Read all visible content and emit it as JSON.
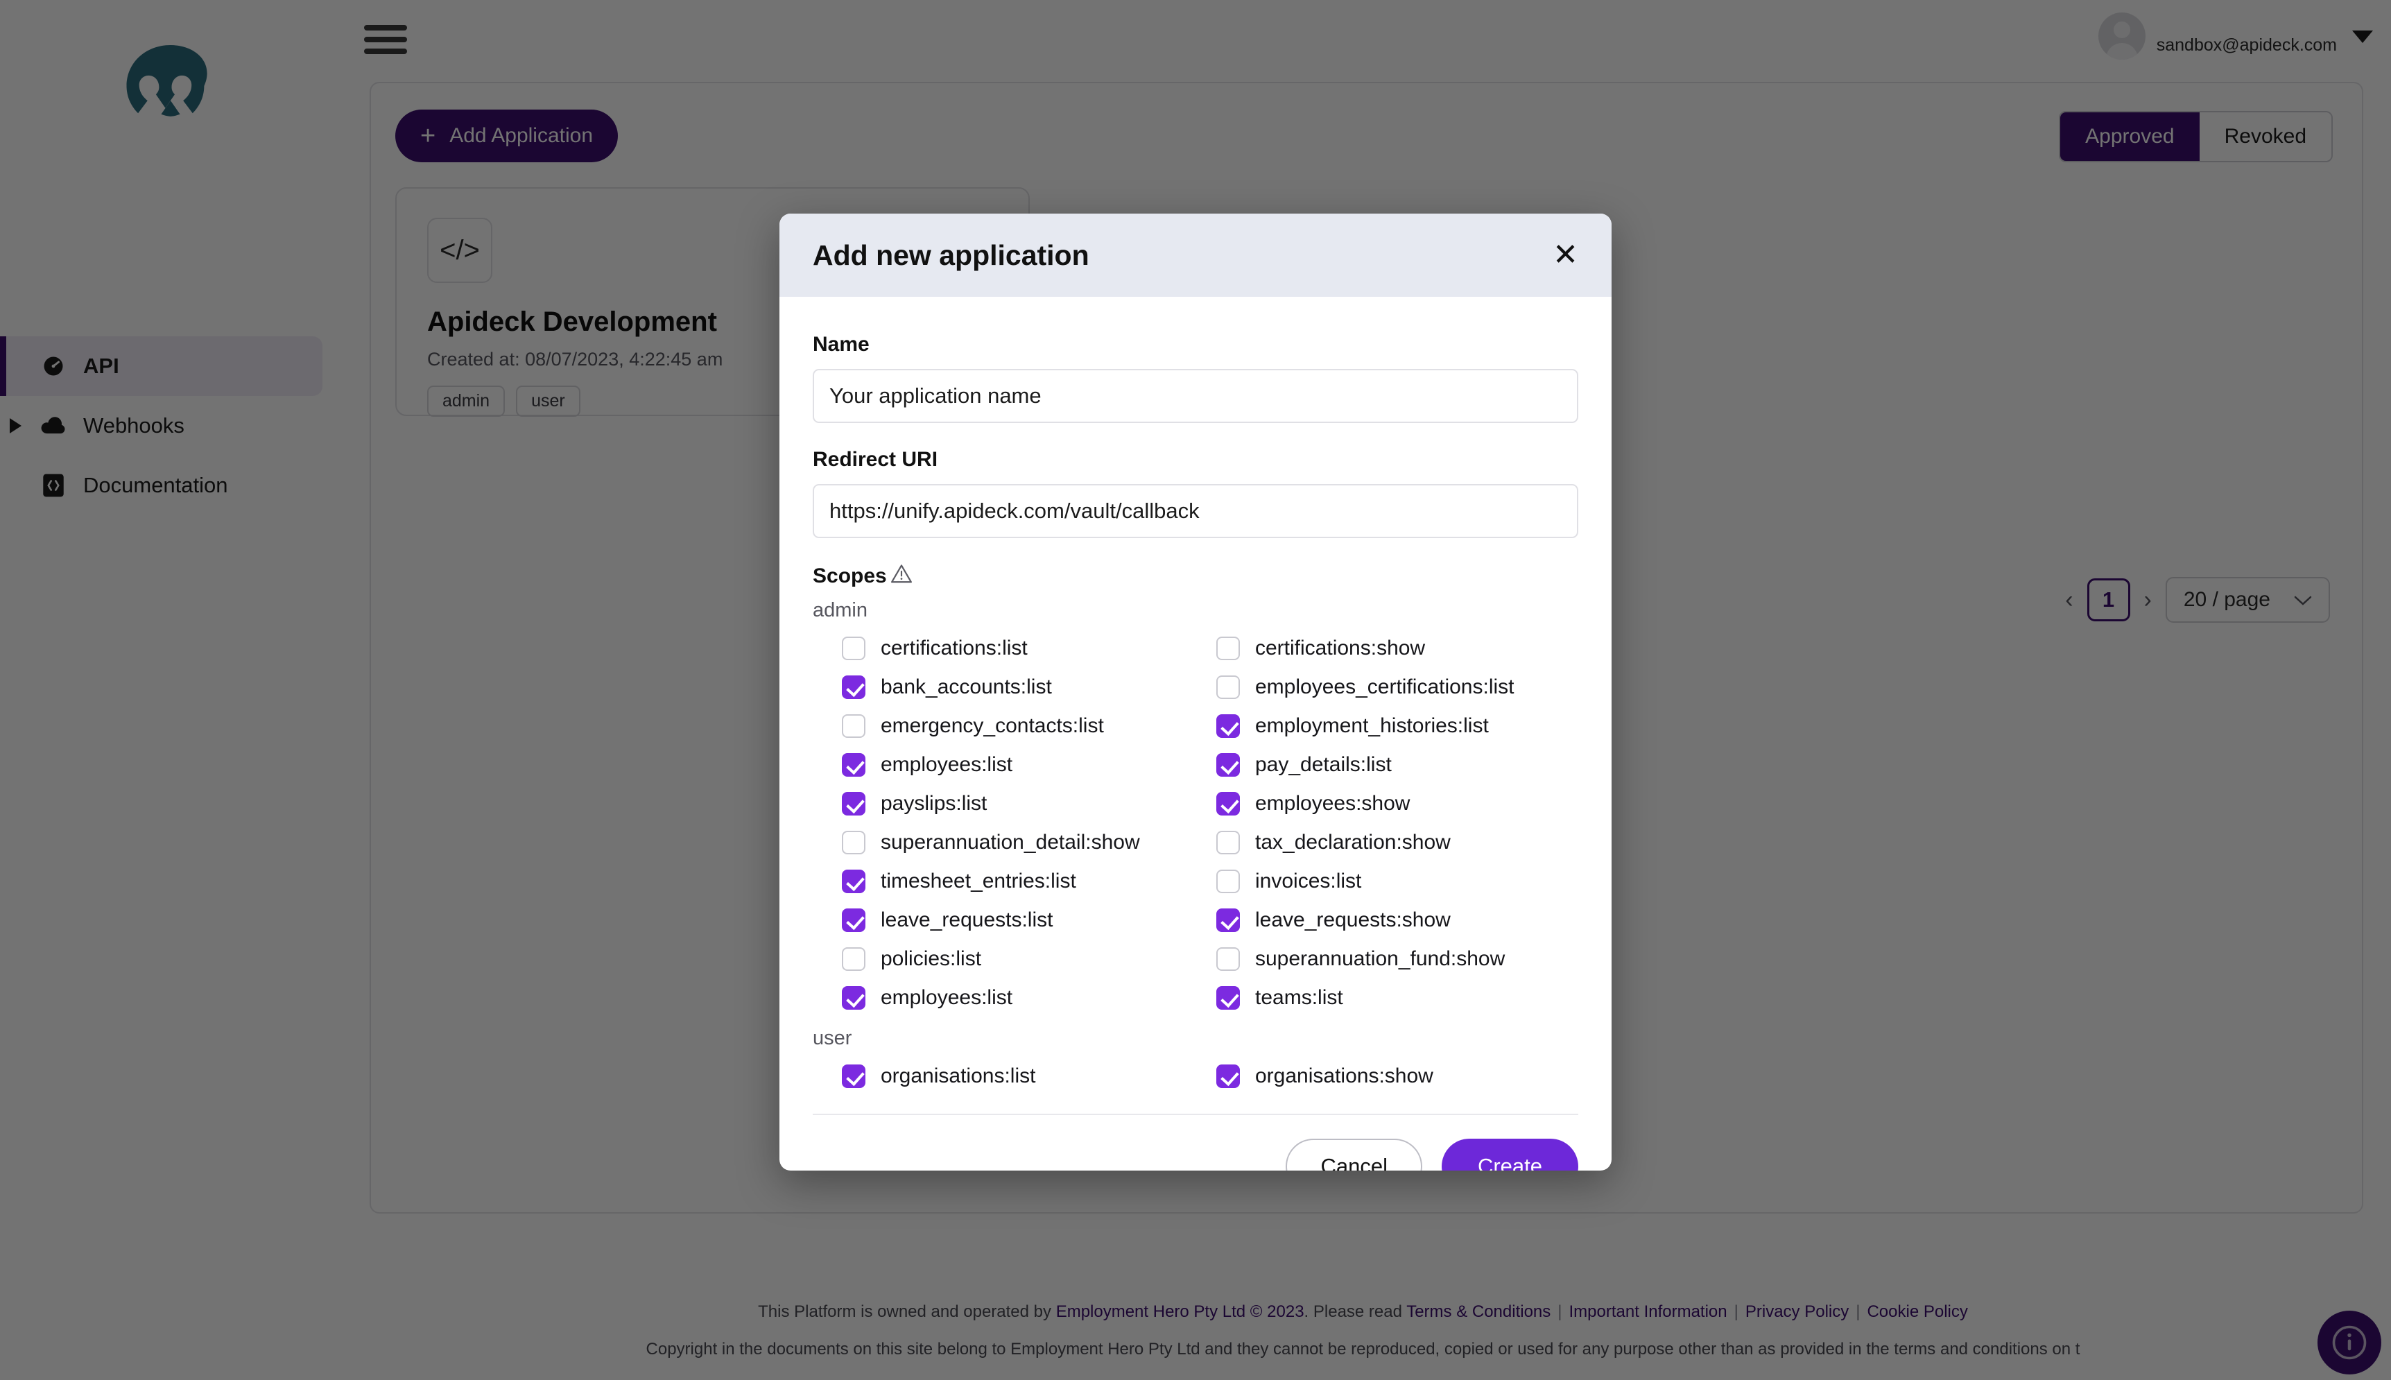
{
  "colors": {
    "brand_purple": "#3d0f70",
    "accent_purple": "#7c2ae0",
    "create_purple": "#6d28d9",
    "logo_teal": "#2b6b7d",
    "modal_header_bg": "#e6e9f1"
  },
  "sidebar": {
    "logo_name": "employment-hero-logo",
    "items": [
      {
        "label": "API",
        "icon": "speedometer-icon",
        "active": true,
        "has_caret": false
      },
      {
        "label": "Webhooks",
        "icon": "cloud-icon",
        "active": false,
        "has_caret": true
      },
      {
        "label": "Documentation",
        "icon": "book-code-icon",
        "active": false,
        "has_caret": false
      }
    ]
  },
  "topbar": {
    "menu_icon": "hamburger-menu-icon",
    "user_email": "sandbox@apideck.com",
    "avatar_icon": "user-avatar-icon",
    "chevron_icon": "chevron-down-icon"
  },
  "main": {
    "add_application_label": "Add Application",
    "add_application_plus": "+",
    "segmented": [
      {
        "label": "Approved",
        "active": true
      },
      {
        "label": "Revoked",
        "active": false
      }
    ],
    "app_card": {
      "icon": "code-brackets-icon",
      "icon_glyph": "</>",
      "title": "Apideck Development",
      "created": "Created at: 08/07/2023, 4:22:45 am",
      "chips": [
        "admin",
        "user"
      ]
    },
    "pagination": {
      "prev": "‹",
      "page": "1",
      "next": "›",
      "page_size": "20 / page",
      "page_size_chevron": "⌄"
    }
  },
  "footer": {
    "line1_prefix": "This Platform is owned and operated by ",
    "line1_owner": "Employment Hero Pty Ltd © 2023",
    "line1_mid": ". Please read ",
    "links": [
      "Terms & Conditions",
      "Important Information",
      "Privacy Policy",
      "Cookie Policy"
    ],
    "line2": "Copyright in the documents on this site belong to Employment Hero Pty Ltd and they cannot be reproduced, copied or used for any purpose other than as provided in the terms and conditions on t",
    "help_icon": "info-circle-icon",
    "help_glyph": "i"
  },
  "modal": {
    "title": "Add new application",
    "close_icon": "close-icon",
    "close_glyph": "✕",
    "name_label": "Name",
    "name_value": "Your application name",
    "name_placeholder": "Your application name",
    "redirect_label": "Redirect URI",
    "redirect_value": "https://unify.apideck.com/vault/callback",
    "redirect_placeholder": "https://unify.apideck.com/vault/callback",
    "scopes_label": "Scopes",
    "scopes_warning_icon": "warning-triangle-icon",
    "groups": [
      {
        "name": "admin",
        "scopes": [
          {
            "label": "certifications:list",
            "checked": false
          },
          {
            "label": "certifications:show",
            "checked": false
          },
          {
            "label": "bank_accounts:list",
            "checked": true
          },
          {
            "label": "employees_certifications:list",
            "checked": false
          },
          {
            "label": "emergency_contacts:list",
            "checked": false
          },
          {
            "label": "employment_histories:list",
            "checked": true
          },
          {
            "label": "employees:list",
            "checked": true
          },
          {
            "label": "pay_details:list",
            "checked": true
          },
          {
            "label": "payslips:list",
            "checked": true
          },
          {
            "label": "employees:show",
            "checked": true
          },
          {
            "label": "superannuation_detail:show",
            "checked": false
          },
          {
            "label": "tax_declaration:show",
            "checked": false
          },
          {
            "label": "timesheet_entries:list",
            "checked": true
          },
          {
            "label": "invoices:list",
            "checked": false
          },
          {
            "label": "leave_requests:list",
            "checked": true
          },
          {
            "label": "leave_requests:show",
            "checked": true
          },
          {
            "label": "policies:list",
            "checked": false
          },
          {
            "label": "superannuation_fund:show",
            "checked": false
          },
          {
            "label": "employees:list",
            "checked": true
          },
          {
            "label": "teams:list",
            "checked": true
          }
        ]
      },
      {
        "name": "user",
        "scopes": [
          {
            "label": "organisations:list",
            "checked": true
          },
          {
            "label": "organisations:show",
            "checked": true
          }
        ]
      }
    ],
    "cancel_label": "Cancel",
    "create_label": "Create"
  }
}
